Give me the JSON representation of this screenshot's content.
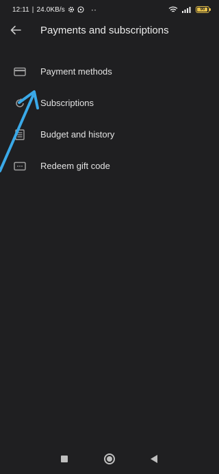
{
  "status_bar": {
    "time": "12:11",
    "separator": "|",
    "net_speed": "24.0KB/s",
    "dots": "··",
    "battery_level": "90",
    "icons": [
      "settings-gear-icon",
      "whatsapp-icon",
      "wifi-icon",
      "signal-icon",
      "battery-icon"
    ]
  },
  "app_bar": {
    "title": "Payments and subscriptions",
    "back_icon": "arrow-back-icon"
  },
  "menu": {
    "items": [
      {
        "label": "Payment methods",
        "icon": "credit-card-icon"
      },
      {
        "label": "Subscriptions",
        "icon": "refresh-icon"
      },
      {
        "label": "Budget and history",
        "icon": "list-document-icon"
      },
      {
        "label": "Redeem gift code",
        "icon": "gift-card-icon"
      }
    ]
  },
  "annotation": {
    "color": "#3aa9e8",
    "icon": "pointer-arrow"
  },
  "nav_bar": {
    "icons": [
      "recent-apps-icon",
      "home-icon",
      "back-icon"
    ]
  },
  "colors": {
    "background": "#1f1f21",
    "text": "#e2e2e2",
    "icon": "#9e9e9e",
    "battery": "#e8c14a"
  }
}
